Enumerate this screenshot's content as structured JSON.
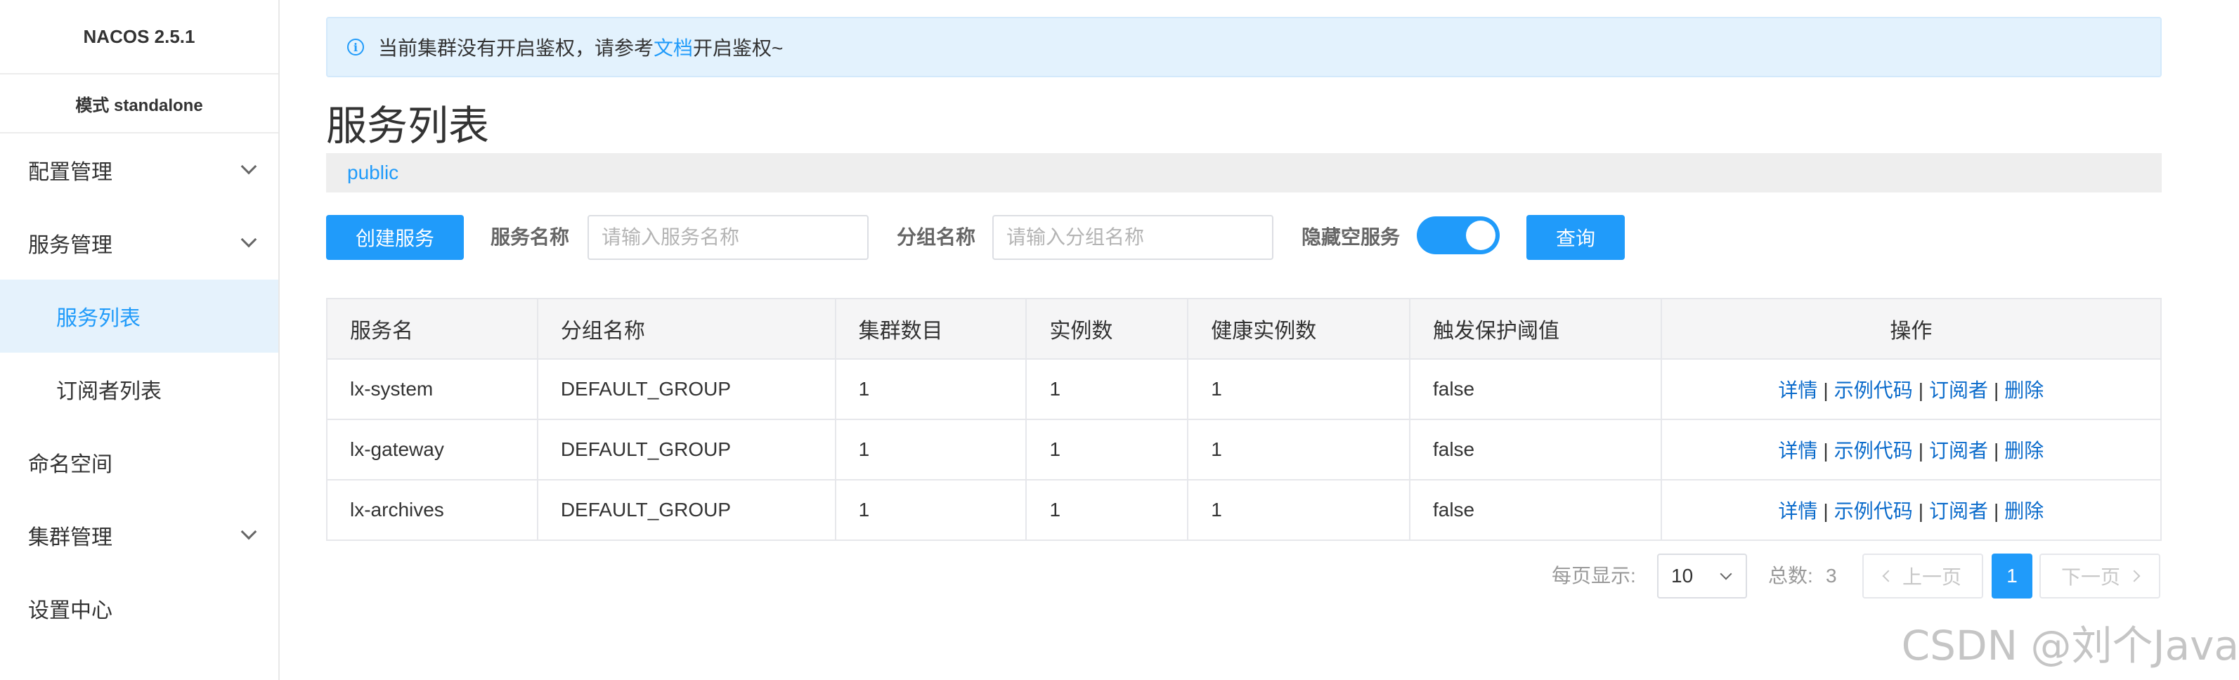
{
  "sidebar": {
    "brand": "NACOS 2.5.1",
    "mode": "模式 standalone",
    "items": [
      {
        "label": "配置管理"
      },
      {
        "label": "服务管理"
      },
      {
        "label": "服务列表"
      },
      {
        "label": "订阅者列表"
      },
      {
        "label": "命名空间"
      },
      {
        "label": "集群管理"
      },
      {
        "label": "设置中心"
      }
    ]
  },
  "notice": {
    "text_before": "当前集群没有开启鉴权，请参考",
    "link": "文档",
    "text_after": "开启鉴权~"
  },
  "page": {
    "title": "服务列表",
    "namespace": "public"
  },
  "toolbar": {
    "create_label": "创建服务",
    "service_name_label": "服务名称",
    "service_name_placeholder": "请输入服务名称",
    "group_name_label": "分组名称",
    "group_name_placeholder": "请输入分组名称",
    "hide_empty_label": "隐藏空服务",
    "query_label": "查询"
  },
  "table": {
    "headers": [
      "服务名",
      "分组名称",
      "集群数目",
      "实例数",
      "健康实例数",
      "触发保护阈值",
      "操作"
    ],
    "rows": [
      {
        "name": "lx-system",
        "group": "DEFAULT_GROUP",
        "clusters": "1",
        "instances": "1",
        "healthy": "1",
        "threshold": "false"
      },
      {
        "name": "lx-gateway",
        "group": "DEFAULT_GROUP",
        "clusters": "1",
        "instances": "1",
        "healthy": "1",
        "threshold": "false"
      },
      {
        "name": "lx-archives",
        "group": "DEFAULT_GROUP",
        "clusters": "1",
        "instances": "1",
        "healthy": "1",
        "threshold": "false"
      }
    ],
    "ops": {
      "detail": "详情",
      "sample": "示例代码",
      "subscriber": "订阅者",
      "delete": "删除",
      "sep": "|"
    }
  },
  "pagination": {
    "per_page_label": "每页显示:",
    "per_page_value": "10",
    "total_label": "总数:",
    "total_value": "3",
    "prev_label": "上一页",
    "current_page": "1",
    "next_label": "下一页"
  },
  "watermark": "CSDN @刘个Java",
  "colors": {
    "accent": "#209bfa",
    "link": "#0b6bcb",
    "notice_bg": "#e3f2fd",
    "sidebar_active_bg": "#e5f2fc"
  }
}
